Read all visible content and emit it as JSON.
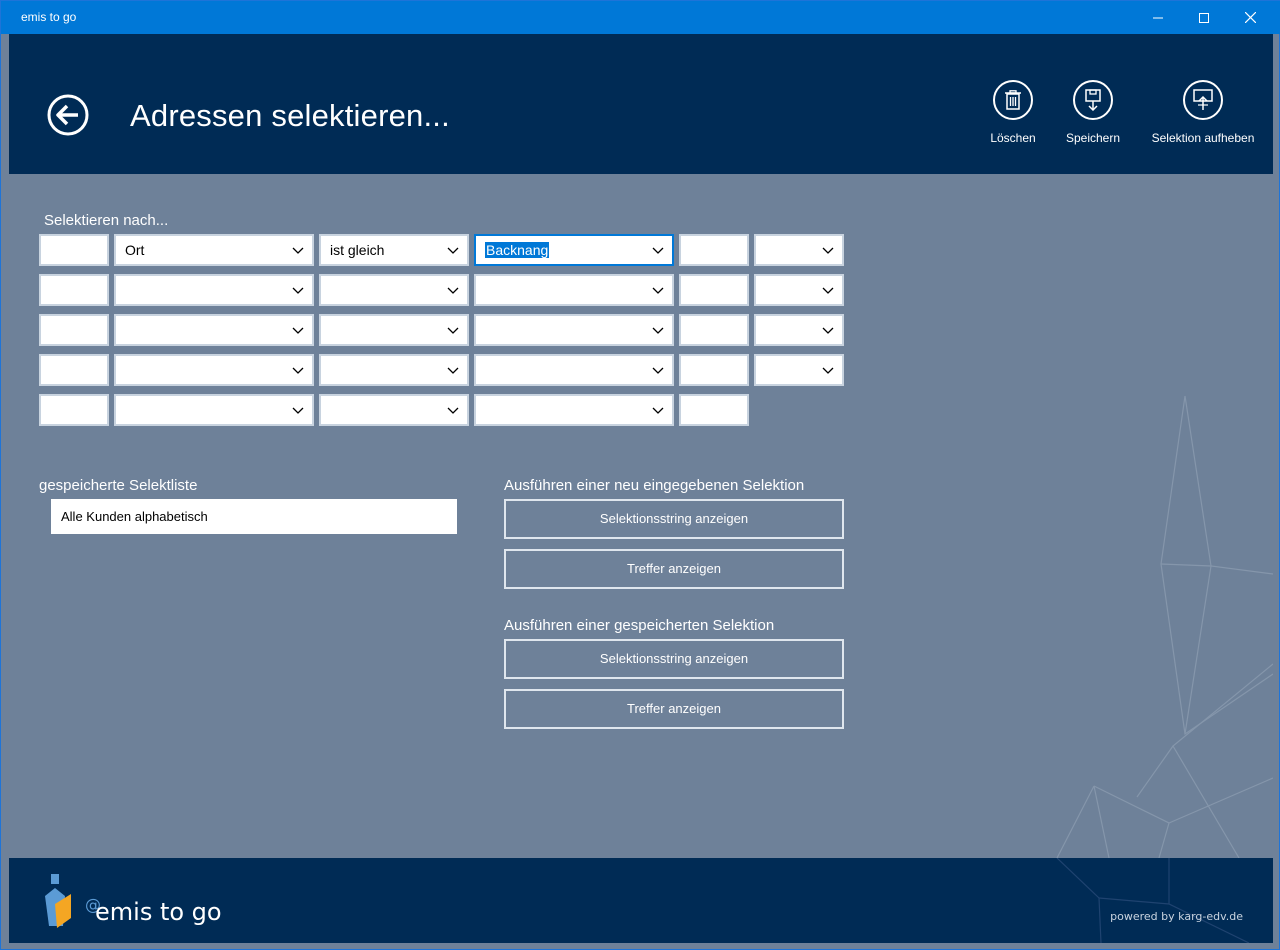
{
  "window": {
    "title": "emis to go"
  },
  "header": {
    "page_title": "Adressen selektieren...",
    "actions": {
      "delete_label": "Löschen",
      "save_label": "Speichern",
      "clear_label": "Selektion aufheben"
    }
  },
  "selection": {
    "label": "Selektieren nach...",
    "rows": [
      {
        "field": "Ort",
        "operator": "ist gleich",
        "value": "Backnang",
        "connector": ""
      },
      {
        "field": "",
        "operator": "",
        "value": "",
        "connector": ""
      },
      {
        "field": "",
        "operator": "",
        "value": "",
        "connector": ""
      },
      {
        "field": "",
        "operator": "",
        "value": "",
        "connector": ""
      },
      {
        "field": "",
        "operator": "",
        "value": ""
      }
    ]
  },
  "saved_list": {
    "label": "gespeicherte Selektliste",
    "items": [
      "Alle Kunden alphabetisch"
    ]
  },
  "new_selection": {
    "label": "Ausführen einer neu eingegebenen Selektion",
    "show_string_label": "Selektionsstring anzeigen",
    "show_hits_label": "Treffer anzeigen"
  },
  "saved_selection": {
    "label": "Ausführen einer gespeicherten Selektion",
    "show_string_label": "Selektionsstring anzeigen",
    "show_hits_label": "Treffer anzeigen"
  },
  "footer": {
    "logo_text": "emis to go",
    "powered_by": "powered by karg-edv.de"
  },
  "colors": {
    "titlebar": "#0078d7",
    "header": "#002b55",
    "content": "#6e8199",
    "focus": "#0078d7"
  }
}
